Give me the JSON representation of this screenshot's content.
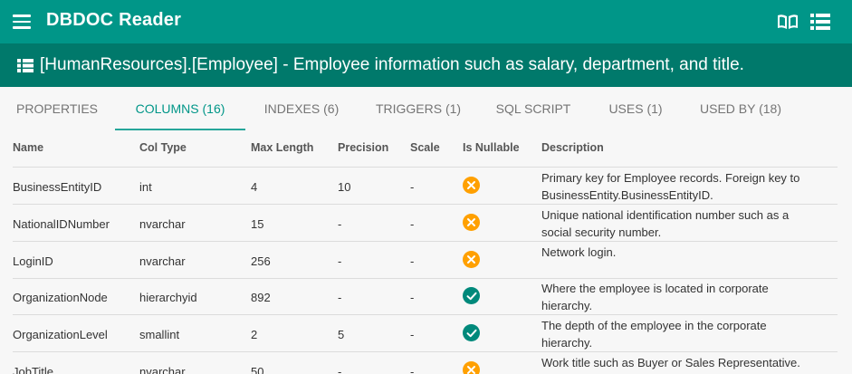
{
  "app": {
    "title": "DBDOC Reader"
  },
  "page": {
    "title": "[HumanResources].[Employee] - Employee information such as salary, department, and title."
  },
  "tabs": [
    {
      "label": "PROPERTIES"
    },
    {
      "label": "COLUMNS (16)"
    },
    {
      "label": "INDEXES (6)"
    },
    {
      "label": "TRIGGERS (1)"
    },
    {
      "label": "SQL SCRIPT"
    },
    {
      "label": "USES (1)"
    },
    {
      "label": "USED BY (18)"
    }
  ],
  "columns_table": {
    "headers": [
      "Name",
      "Col Type",
      "Max Length",
      "Precision",
      "Scale",
      "Is Nullable",
      "Description"
    ],
    "rows": [
      {
        "name": "BusinessEntityID",
        "type": "int",
        "max_length": "4",
        "precision": "10",
        "scale": "-",
        "nullable": false,
        "description": "Primary key for Employee records. Foreign key to BusinessEntity.BusinessEntityID."
      },
      {
        "name": "NationalIDNumber",
        "type": "nvarchar",
        "max_length": "15",
        "precision": "-",
        "scale": "-",
        "nullable": false,
        "description": "Unique national identification number such as a social security number."
      },
      {
        "name": "LoginID",
        "type": "nvarchar",
        "max_length": "256",
        "precision": "-",
        "scale": "-",
        "nullable": false,
        "description": "Network login."
      },
      {
        "name": "OrganizationNode",
        "type": "hierarchyid",
        "max_length": "892",
        "precision": "-",
        "scale": "-",
        "nullable": true,
        "description": "Where the employee is located in corporate hierarchy."
      },
      {
        "name": "OrganizationLevel",
        "type": "smallint",
        "max_length": "2",
        "precision": "5",
        "scale": "-",
        "nullable": true,
        "description": "The depth of the employee in the corporate hierarchy."
      },
      {
        "name": "JobTitle",
        "type": "nvarchar",
        "max_length": "50",
        "precision": "-",
        "scale": "-",
        "nullable": false,
        "description": "Work title such as Buyer or Sales Representative."
      }
    ]
  },
  "icons": {
    "menu": "menu-icon",
    "book": "book-icon",
    "list": "list-icon",
    "table": "table-icon",
    "not_nullable": "close-circle-icon",
    "nullable": "check-circle-icon"
  },
  "colors": {
    "appbar": "#009688",
    "titlebar": "#00796b",
    "accent": "#26a69a",
    "not_nullable": "#ffa000",
    "nullable": "#00897b"
  }
}
